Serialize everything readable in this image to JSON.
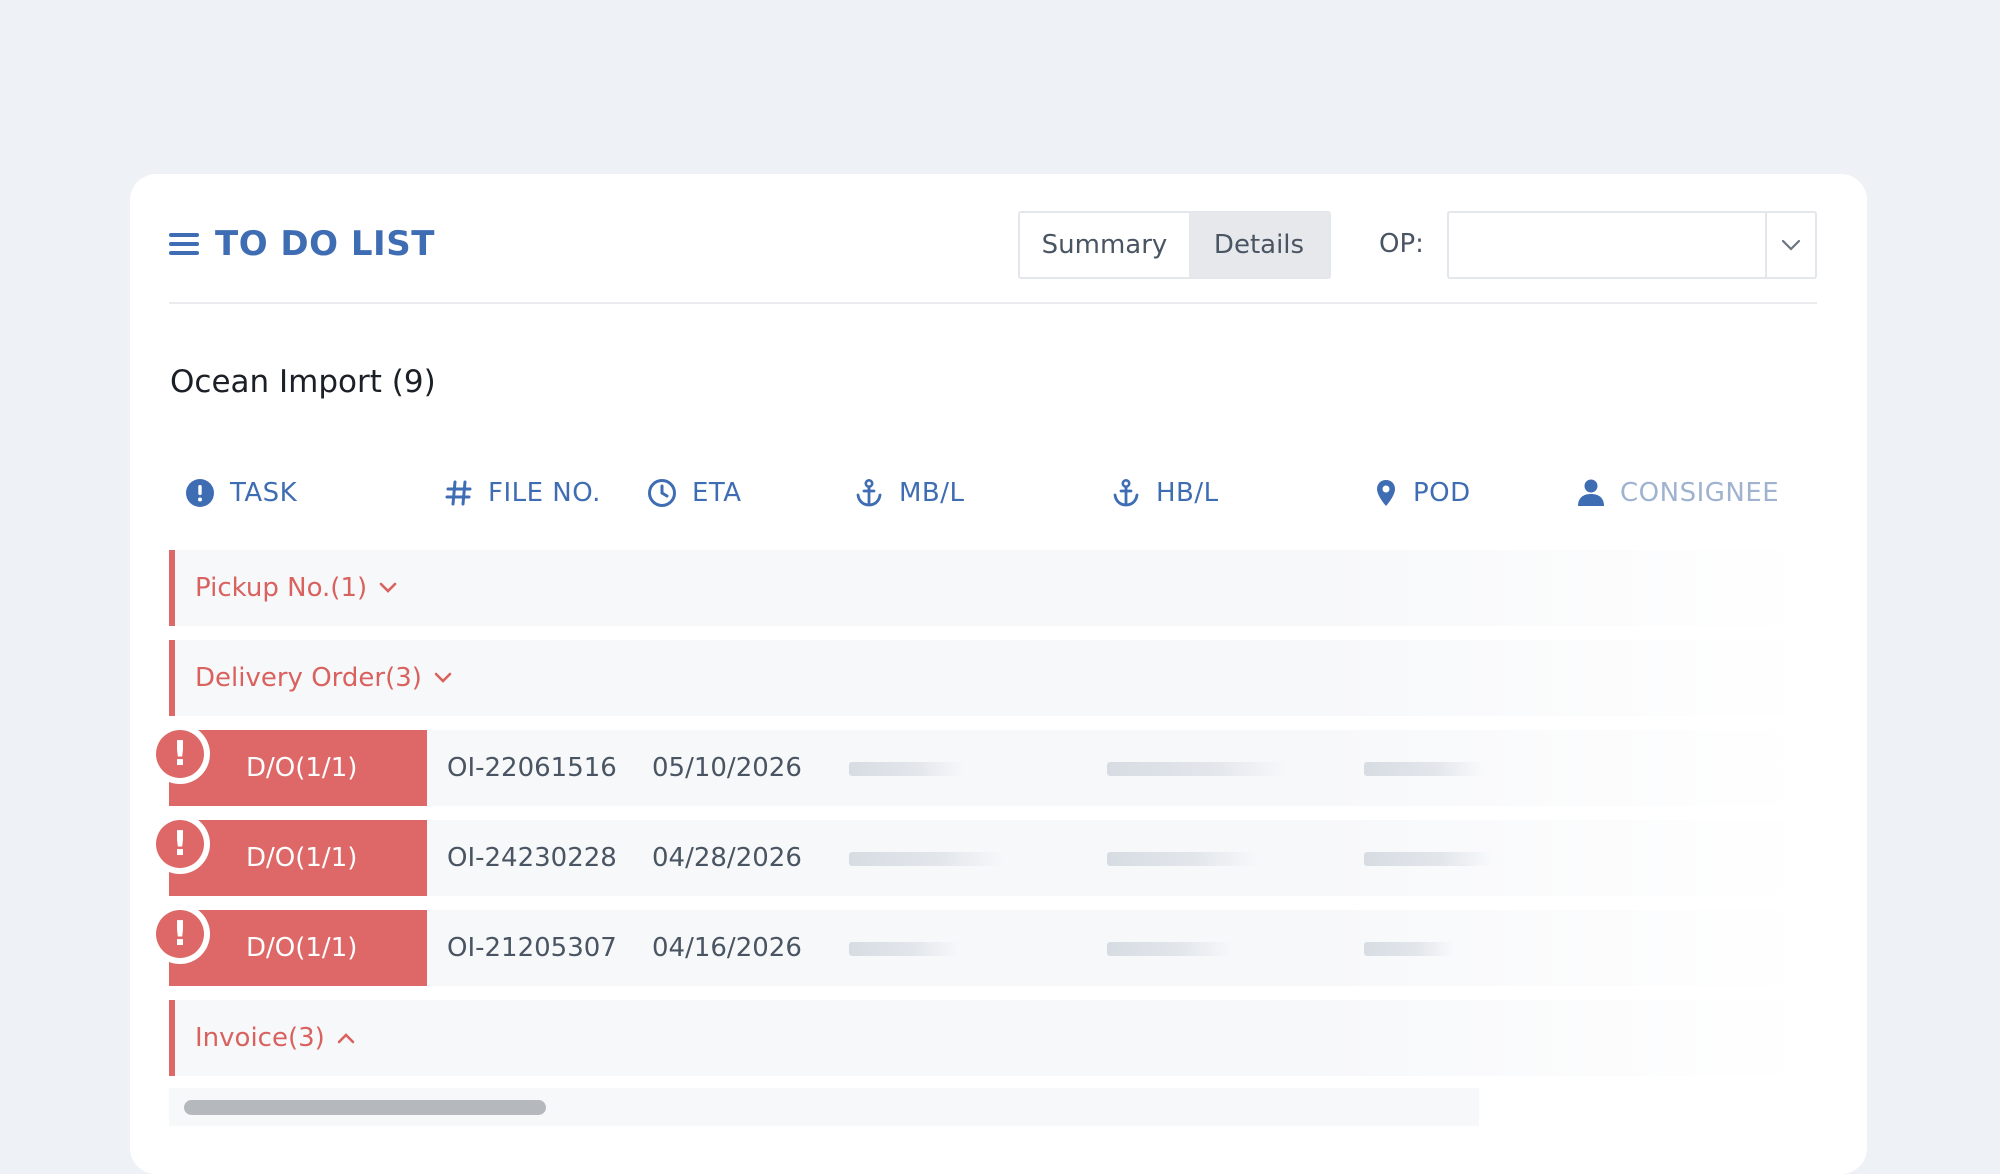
{
  "header": {
    "title": "TO DO LIST",
    "view_toggle": [
      {
        "label": "Summary",
        "active": false
      },
      {
        "label": "Details",
        "active": true
      }
    ],
    "op_label": "OP:",
    "op_value": ""
  },
  "section": {
    "title": "Ocean Import (9)"
  },
  "columns": [
    {
      "label": "TASK",
      "icon": "alert-circle-icon"
    },
    {
      "label": "FILE NO.",
      "icon": "hash-icon"
    },
    {
      "label": "ETA",
      "icon": "clock-icon"
    },
    {
      "label": "MB/L",
      "icon": "anchor-icon"
    },
    {
      "label": "HB/L",
      "icon": "anchor-icon"
    },
    {
      "label": "POD",
      "icon": "map-pin-icon"
    },
    {
      "label": "CONSIGNEE",
      "icon": "user-icon"
    }
  ],
  "groups": {
    "pickup": {
      "label": "Pickup No.(1)",
      "expanded": false
    },
    "delivery": {
      "label": "Delivery Order(3)",
      "expanded": true
    },
    "invoice": {
      "label": "Invoice(3)",
      "expanded": true
    }
  },
  "delivery_rows": [
    {
      "task": "D/O(1/1)",
      "file_no": "OI-22061516",
      "eta": "05/10/2026"
    },
    {
      "task": "D/O(1/1)",
      "file_no": "OI-24230228",
      "eta": "04/28/2026"
    },
    {
      "task": "D/O(1/1)",
      "file_no": "OI-21205307",
      "eta": "04/16/2026"
    }
  ],
  "colors": {
    "accent": "#3f6db3",
    "alert": "#dd6867",
    "alert_text": "#d9625f",
    "background": "#eef1f5"
  },
  "alert_glyph": "!"
}
